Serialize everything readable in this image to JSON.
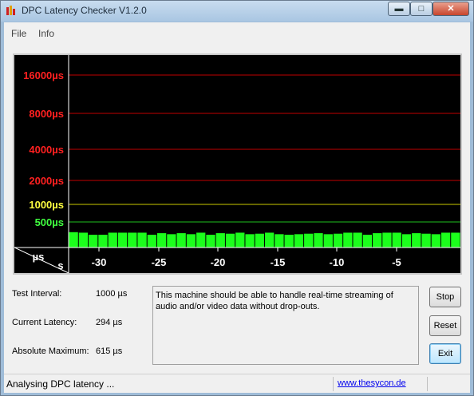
{
  "window": {
    "title": "DPC Latency Checker V1.2.0"
  },
  "menu": {
    "items": [
      "File",
      "Info"
    ]
  },
  "graph": {
    "y_labels": [
      {
        "text": "16000µs",
        "color": "#ff2020",
        "line": "#c00000"
      },
      {
        "text": "8000µs",
        "color": "#ff2020",
        "line": "#c00000"
      },
      {
        "text": "4000µs",
        "color": "#ff2020",
        "line": "#c00000"
      },
      {
        "text": "2000µs",
        "color": "#ff2020",
        "line": "#c00000"
      },
      {
        "text": "1000µs",
        "color": "#ffff40",
        "line": "#c8c800"
      },
      {
        "text": "500µs",
        "color": "#40ff40",
        "line": "#20c020"
      }
    ],
    "unit_y": "µs",
    "unit_x": "s",
    "x_labels": [
      "-30",
      "-25",
      "-20",
      "-15",
      "-10",
      "-5"
    ],
    "bar_color": "#1cff1c",
    "bars": [
      300,
      290,
      250,
      250,
      290,
      290,
      290,
      290,
      250,
      280,
      260,
      280,
      260,
      290,
      250,
      280,
      270,
      290,
      260,
      270,
      290,
      260,
      250,
      260,
      270,
      280,
      260,
      270,
      290,
      290,
      250,
      280,
      290,
      290,
      260,
      280,
      270,
      260,
      290,
      290
    ]
  },
  "info": {
    "test_interval_label": "Test Interval:",
    "test_interval_value": "1000 µs",
    "current_latency_label": "Current Latency:",
    "current_latency_value": "294 µs",
    "absolute_max_label": "Absolute Maximum:",
    "absolute_max_value": "615 µs"
  },
  "message": "This machine should be able to handle real-time streaming of audio and/or video data without drop-outs.",
  "buttons": {
    "stop": "Stop",
    "reset": "Reset",
    "exit": "Exit"
  },
  "status": {
    "text": "Analysing DPC latency ...",
    "link": "www.thesycon.de"
  }
}
